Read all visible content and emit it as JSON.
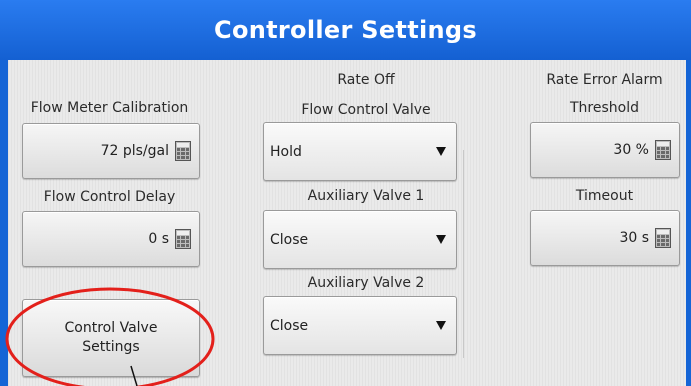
{
  "header": {
    "title": "Controller Settings"
  },
  "left": {
    "flow_meter_label": "Flow Meter Calibration",
    "flow_meter_value": "72 pls/gal",
    "flow_delay_label": "Flow Control Delay",
    "flow_delay_value": "0 s",
    "control_valve_button": [
      "Control Valve",
      "Settings"
    ]
  },
  "middle": {
    "group_heading": "Rate Off",
    "flow_valve_label": "Flow Control Valve",
    "flow_valve_value": "Hold",
    "aux1_label": "Auxiliary Valve 1",
    "aux1_value": "Close",
    "aux2_label": "Auxiliary Valve 2",
    "aux2_value": "Close"
  },
  "right": {
    "group_heading": "Rate Error Alarm",
    "threshold_label": "Threshold",
    "threshold_value": "30 %",
    "timeout_label": "Timeout",
    "timeout_value": "30 s"
  },
  "icons": {
    "numeric_entry": "calculator-icon",
    "dropdown": "triangle-down-icon"
  },
  "colors": {
    "title_bar": "#1565d6",
    "highlight_ring": "#e3201b"
  }
}
